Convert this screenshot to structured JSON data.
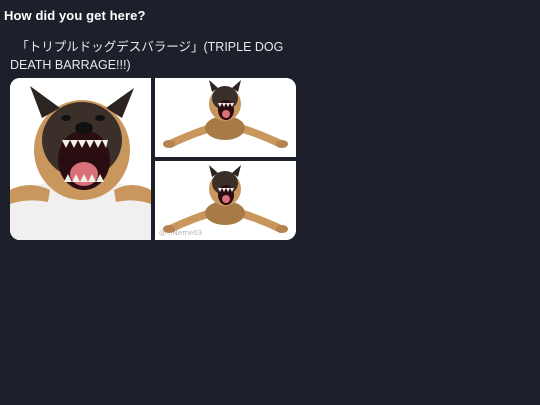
{
  "heading": "How did you get here?",
  "post": {
    "text": "　「トリプルドッグデスバラージ」(TRIPLE DOG DEATH BARRAGE!!!)"
  },
  "media": {
    "tiles": [
      {
        "subject": "dog-face-closeup"
      },
      {
        "subject": "dog-sprawled"
      },
      {
        "subject": "dog-sprawled"
      }
    ],
    "watermark": "@...Neme03"
  },
  "colors": {
    "background": "#1d202b",
    "text": "#ffffff",
    "fur_tan": "#c9965e",
    "fur_dark": "#2b2420",
    "mouth": "#2a0d10",
    "tongue": "#d9707a"
  }
}
